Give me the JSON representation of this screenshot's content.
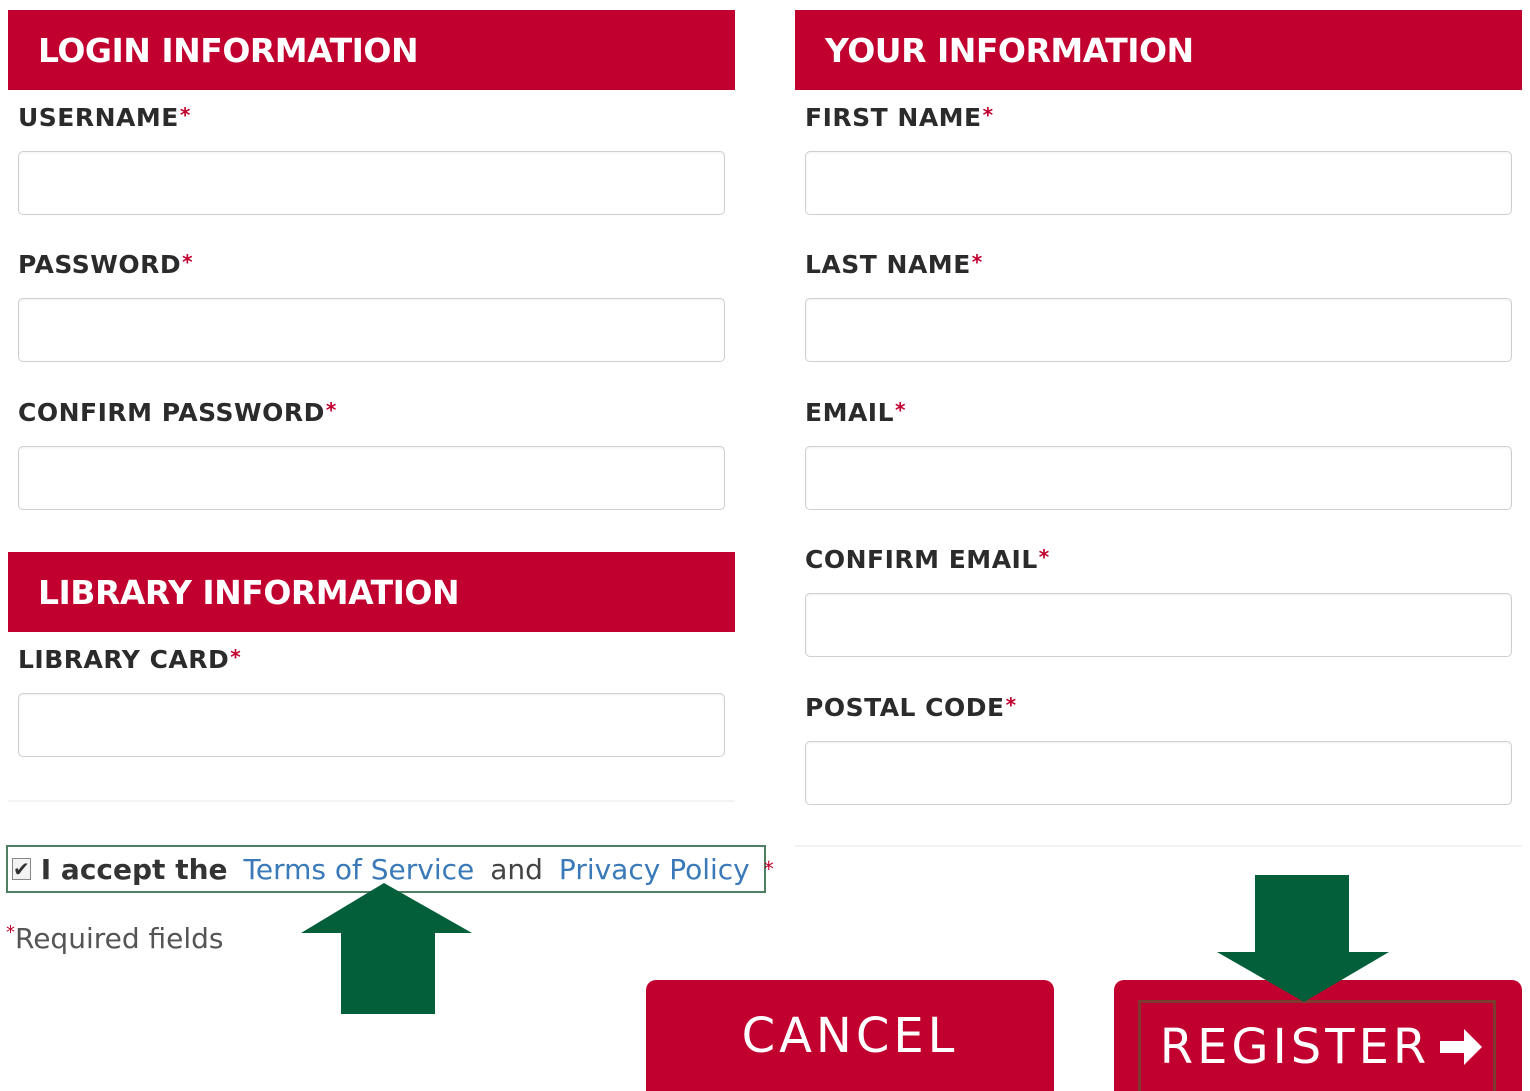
{
  "login": {
    "header": "LOGIN INFORMATION",
    "username_label": "USERNAME",
    "password_label": "PASSWORD",
    "confirm_password_label": "CONFIRM PASSWORD"
  },
  "library": {
    "header": "LIBRARY INFORMATION",
    "card_label": "LIBRARY CARD"
  },
  "your_info": {
    "header": "YOUR INFORMATION",
    "first_name_label": "FIRST NAME",
    "last_name_label": "LAST NAME",
    "email_label": "EMAIL",
    "confirm_email_label": "CONFIRM EMAIL",
    "postal_code_label": "POSTAL CODE"
  },
  "required_marker": "*",
  "terms": {
    "checked": true,
    "accept_text": "I accept the",
    "terms_link": "Terms of Service",
    "and_text": "and",
    "privacy_link": "Privacy Policy"
  },
  "required_note": "Required fields",
  "buttons": {
    "cancel": "CANCEL",
    "register": "REGISTER"
  },
  "colors": {
    "brand_red": "#c1002f",
    "link_blue": "#3a7ab8",
    "arrow_green": "#035f3a"
  },
  "icons": {
    "register_arrow": "arrow-right-icon",
    "annotation_up": "arrow-up-icon",
    "annotation_down": "arrow-down-icon"
  }
}
